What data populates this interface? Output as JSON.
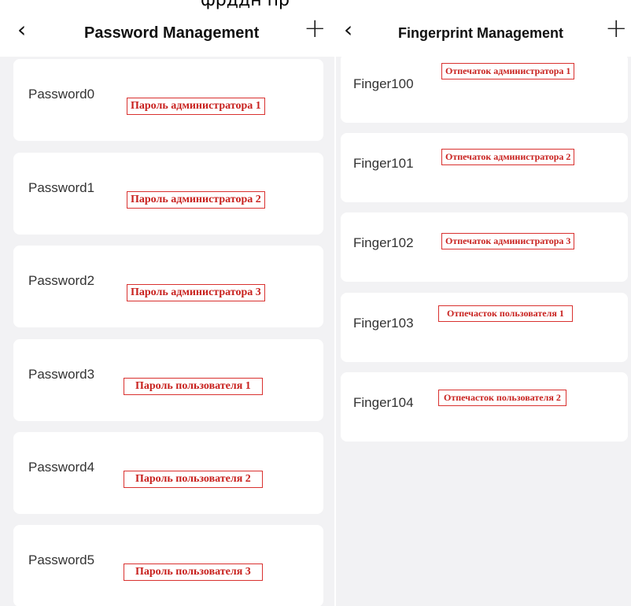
{
  "top_strip": {
    "cut_text": "фрддн    пр"
  },
  "password_screen": {
    "title": "Password Management",
    "back_icon": "‹",
    "add_icon": "+",
    "items": [
      {
        "name": "Password0",
        "note": "Пароль администратора 1"
      },
      {
        "name": "Password1",
        "note": "Пароль администратора 2"
      },
      {
        "name": "Password2",
        "note": "Пароль администратора 3"
      },
      {
        "name": "Password3",
        "note": "Пароль пользователя 1"
      },
      {
        "name": "Password4",
        "note": "Пароль пользователя 2"
      },
      {
        "name": "Password5",
        "note": "Пароль пользователя 3"
      }
    ]
  },
  "fingerprint_screen": {
    "title": "Fingerprint Management",
    "back_icon": "‹",
    "add_icon": "+",
    "items": [
      {
        "name": "Finger100",
        "note": "Отпечаток администратора 1"
      },
      {
        "name": "Finger101",
        "note": "Отпечаток администратора 2"
      },
      {
        "name": "Finger102",
        "note": "Отпечаток администратора 3"
      },
      {
        "name": "Finger103",
        "note": "Отпечасток пользователя 1"
      },
      {
        "name": "Finger104",
        "note": "Отпечасток пользователя 2"
      }
    ]
  },
  "colors": {
    "panel_bg": "#f2f2f4",
    "card_bg": "#ffffff",
    "annotation_red": "#c8211e"
  }
}
